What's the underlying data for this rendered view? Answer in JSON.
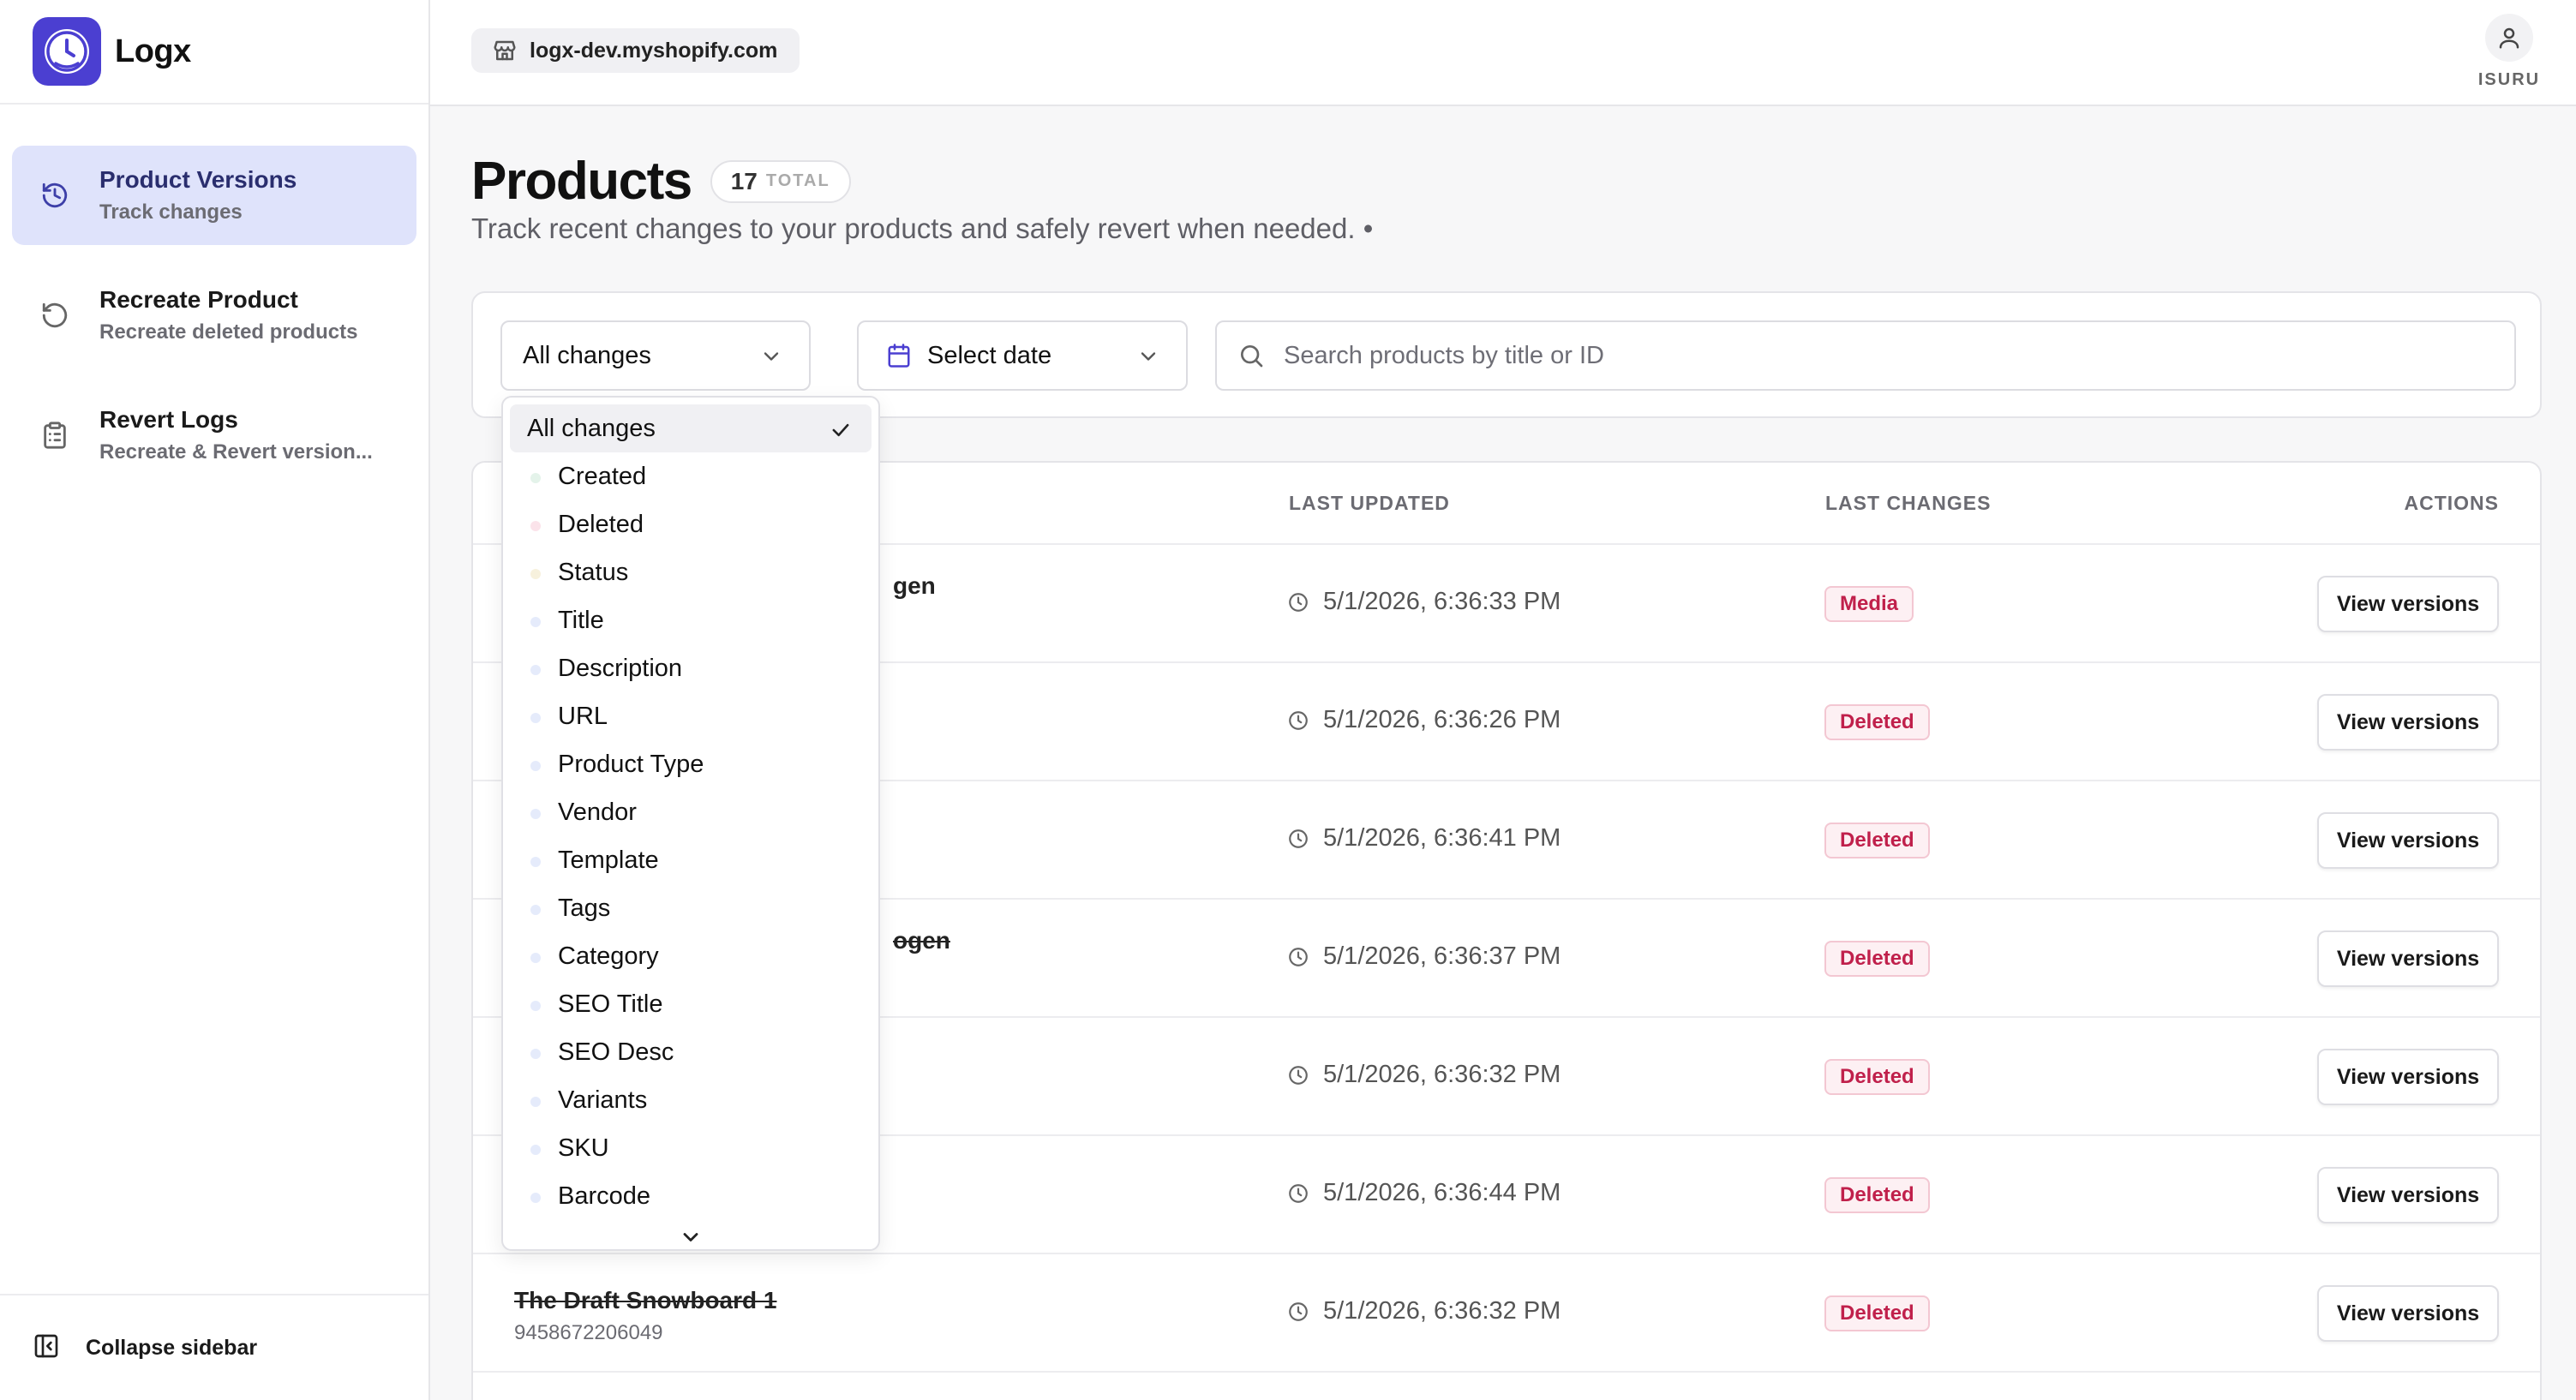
{
  "app": {
    "name": "Logx"
  },
  "sidebar": {
    "items": [
      {
        "title": "Product Versions",
        "subtitle": "Track changes",
        "icon": "history-icon",
        "active": true
      },
      {
        "title": "Recreate Product",
        "subtitle": "Recreate deleted products",
        "icon": "rotate-ccw-icon",
        "active": false
      },
      {
        "title": "Revert Logs",
        "subtitle": "Recreate & Revert version...",
        "icon": "clipboard-list-icon",
        "active": false
      }
    ],
    "collapse_label": "Collapse sidebar"
  },
  "topbar": {
    "store": "logx-dev.myshopify.com",
    "user": "ISURU"
  },
  "page": {
    "title": "Products",
    "count": "17",
    "count_label": "TOTAL",
    "subtitle": "Track recent changes to your products and safely revert when needed. •"
  },
  "filters": {
    "change_type": "All changes",
    "date": "Select date",
    "search_placeholder": "Search products by title or ID"
  },
  "dropdown": {
    "selected": "All changes",
    "options": [
      {
        "label": "Created",
        "dot": "#e4f3ea"
      },
      {
        "label": "Deleted",
        "dot": "#fbe3ea"
      },
      {
        "label": "Status",
        "dot": "#f7f1dd"
      },
      {
        "label": "Title",
        "dot": "#e5ebfb"
      },
      {
        "label": "Description",
        "dot": "#e5ebfb"
      },
      {
        "label": "URL",
        "dot": "#e5ebfb"
      },
      {
        "label": "Product Type",
        "dot": "#e5ebfb"
      },
      {
        "label": "Vendor",
        "dot": "#e5ebfb"
      },
      {
        "label": "Template",
        "dot": "#e5ebfb"
      },
      {
        "label": "Tags",
        "dot": "#e5ebfb"
      },
      {
        "label": "Category",
        "dot": "#e5ebfb"
      },
      {
        "label": "SEO Title",
        "dot": "#e5ebfb"
      },
      {
        "label": "SEO Desc",
        "dot": "#e5ebfb"
      },
      {
        "label": "Variants",
        "dot": "#e5ebfb"
      },
      {
        "label": "SKU",
        "dot": "#e5ebfb"
      },
      {
        "label": "Barcode",
        "dot": "#e5ebfb"
      }
    ]
  },
  "table": {
    "headers": {
      "updated": "LAST UPDATED",
      "changes": "LAST CHANGES",
      "actions": "ACTIONS"
    },
    "button_label": "View versions",
    "rows": [
      {
        "name_fragment": "gen",
        "struck": false,
        "updated": "5/1/2026, 6:36:33 PM",
        "change": "Media"
      },
      {
        "name_fragment": "",
        "struck": true,
        "updated": "5/1/2026, 6:36:26 PM",
        "change": "Deleted"
      },
      {
        "name_fragment": "",
        "struck": true,
        "updated": "5/1/2026, 6:36:41 PM",
        "change": "Deleted"
      },
      {
        "name_fragment": "ogen",
        "struck": true,
        "updated": "5/1/2026, 6:36:37 PM",
        "change": "Deleted"
      },
      {
        "name_fragment": "",
        "struck": true,
        "updated": "5/1/2026, 6:36:32 PM",
        "change": "Deleted"
      },
      {
        "name_fragment": "",
        "struck": true,
        "updated": "5/1/2026, 6:36:44 PM",
        "change": "Deleted"
      },
      {
        "name": "The Draft Snowboard 1",
        "id": "9458672206049",
        "struck": true,
        "updated": "5/1/2026, 6:36:32 PM",
        "change": "Deleted"
      }
    ]
  },
  "colors": {
    "accent": "#4b3fd1",
    "active_nav_bg": "#dfe3fb",
    "badge_text": "#c0204b",
    "badge_bg": "#fdf0f3"
  }
}
